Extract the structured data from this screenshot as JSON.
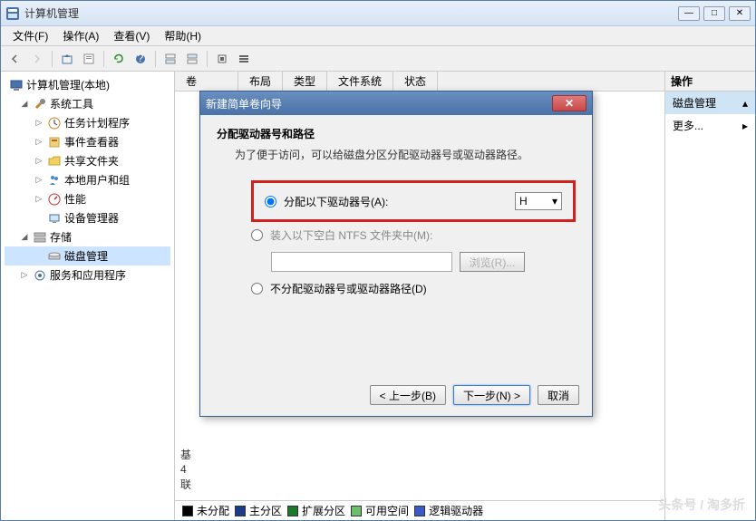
{
  "window": {
    "title": "计算机管理",
    "controls": {
      "min": "—",
      "max": "□",
      "close": "✕"
    }
  },
  "menubar": [
    {
      "label": "文件(F)"
    },
    {
      "label": "操作(A)"
    },
    {
      "label": "查看(V)"
    },
    {
      "label": "帮助(H)"
    }
  ],
  "tree": {
    "root": "计算机管理(本地)",
    "system_tools": "系统工具",
    "task_scheduler": "任务计划程序",
    "event_viewer": "事件查看器",
    "shared_folders": "共享文件夹",
    "local_users": "本地用户和组",
    "performance": "性能",
    "device_manager": "设备管理器",
    "storage": "存储",
    "disk_management": "磁盘管理",
    "services": "服务和应用程序"
  },
  "tabs": [
    "卷",
    "布局",
    "类型",
    "文件系统",
    "状态"
  ],
  "right_panel": {
    "header": "操作",
    "disk_mgmt": "磁盘管理",
    "more": "更多..."
  },
  "dialog": {
    "title": "新建简单卷向导",
    "heading": "分配驱动器号和路径",
    "subtext": "为了便于访问，可以给磁盘分区分配驱动器号或驱动器路径。",
    "option_assign": "分配以下驱动器号(A):",
    "drive_letter": "H",
    "option_mount": "装入以下空白 NTFS 文件夹中(M):",
    "browse": "浏览(R)...",
    "option_none": "不分配驱动器号或驱动器路径(D)",
    "btn_back": "< 上一步(B)",
    "btn_next": "下一步(N) >",
    "btn_cancel": "取消"
  },
  "disk_info": {
    "line1": "基",
    "line2": "4",
    "line3": "联"
  },
  "legend": {
    "unallocated": {
      "label": "未分配",
      "color": "#000000"
    },
    "primary": {
      "label": "主分区",
      "color": "#1a3a8a"
    },
    "extended": {
      "label": "扩展分区",
      "color": "#1a7a2a"
    },
    "free": {
      "label": "可用空间",
      "color": "#6ac06a"
    },
    "logical": {
      "label": "逻辑驱动器",
      "color": "#3a5ac8"
    }
  },
  "watermark": "头条号 / 淘多折"
}
